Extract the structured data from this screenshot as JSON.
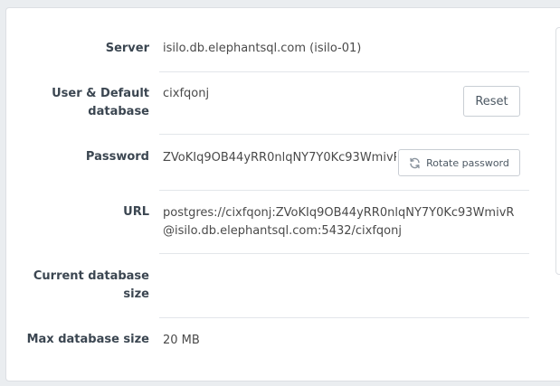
{
  "fields": {
    "server": {
      "label": "Server",
      "value": "isilo.db.elephantsql.com (isilo-01)"
    },
    "user": {
      "label_line1": "User & Default",
      "label_line2": "database",
      "value": "cixfqonj"
    },
    "password": {
      "label": "Password",
      "value": "ZVoKIq9OB44yRR0nlqNY7Y0Kc93WmivR"
    },
    "url": {
      "label": "URL",
      "value_line1": "postgres://cixfqonj:ZVoKIq9OB44yRR0nlqNY7Y0Kc93WmivR",
      "value_line2": "@isilo.db.elephantsql.com:5432/cixfqonj"
    },
    "current_size": {
      "label_line1": "Current database",
      "label_line2": "size",
      "value": ""
    },
    "max_size": {
      "label": "Max database size",
      "value": "20 MB"
    }
  },
  "buttons": {
    "reset_label": "Reset",
    "rotate_label": "Rotate password"
  },
  "icons": {
    "rotate": "refresh-icon"
  }
}
